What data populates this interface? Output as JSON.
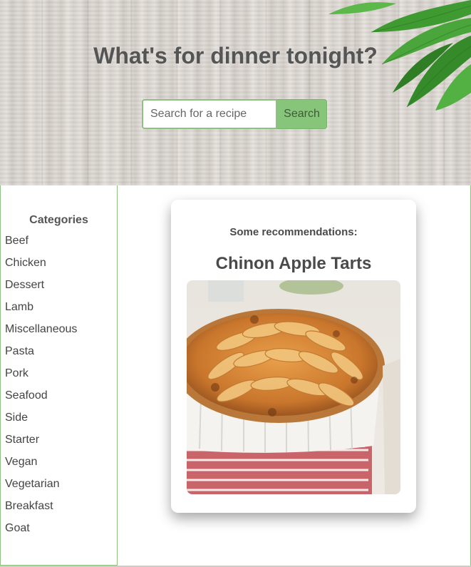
{
  "hero": {
    "title": "What's for dinner tonight?",
    "search_placeholder": "Search for a recipe",
    "search_button": "Search"
  },
  "sidebar": {
    "title": "Categories",
    "categories": [
      "Beef",
      "Chicken",
      "Dessert",
      "Lamb",
      "Miscellaneous",
      "Pasta",
      "Pork",
      "Seafood",
      "Side",
      "Starter",
      "Vegan",
      "Vegetarian",
      "Breakfast",
      "Goat"
    ]
  },
  "recommendation": {
    "heading": "Some recommendations:",
    "recipe_title": "Chinon Apple Tarts",
    "image_icon": "apple-tart-photo"
  },
  "colors": {
    "accent_green": "#86c57a",
    "border_green": "#8fbf82",
    "text": "#4f4f4f"
  }
}
